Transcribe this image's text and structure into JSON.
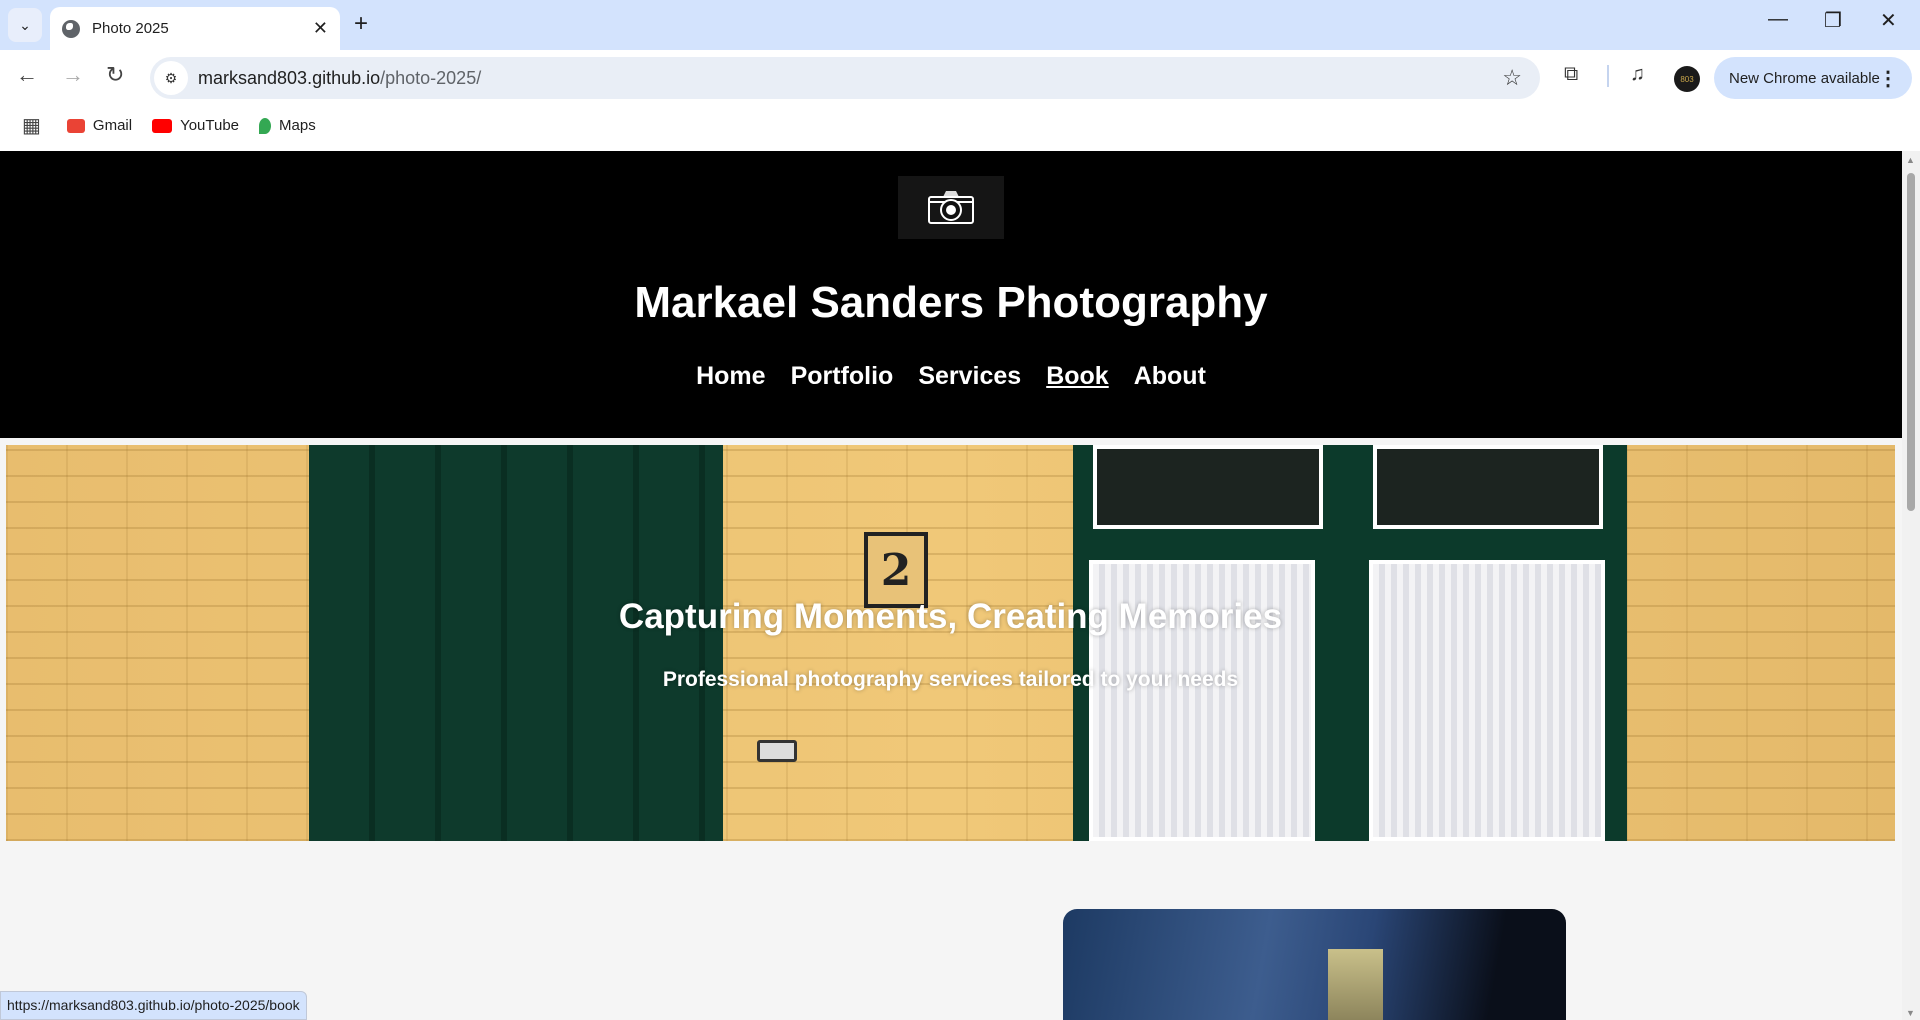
{
  "browser": {
    "tab_title": "Photo 2025",
    "url_host": "marksand803.github.io",
    "url_path": "/photo-2025/",
    "update_label": "New Chrome available",
    "profile_text": "803",
    "bookmarks": [
      {
        "label": "Gmail",
        "color": "#ea4335"
      },
      {
        "label": "YouTube",
        "color": "#ff0000"
      },
      {
        "label": "Maps",
        "color": "#34a853"
      }
    ],
    "status_url": "https://marksand803.github.io/photo-2025/book"
  },
  "site": {
    "title": "Markael Sanders Photography",
    "nav": [
      {
        "label": "Home"
      },
      {
        "label": "Portfolio"
      },
      {
        "label": "Services"
      },
      {
        "label": "Book",
        "active": true
      },
      {
        "label": "About"
      }
    ],
    "hero": {
      "title": "Capturing Moments, Creating Memories",
      "subtitle": "Professional photography services tailored to your needs",
      "house_number": "2"
    }
  }
}
